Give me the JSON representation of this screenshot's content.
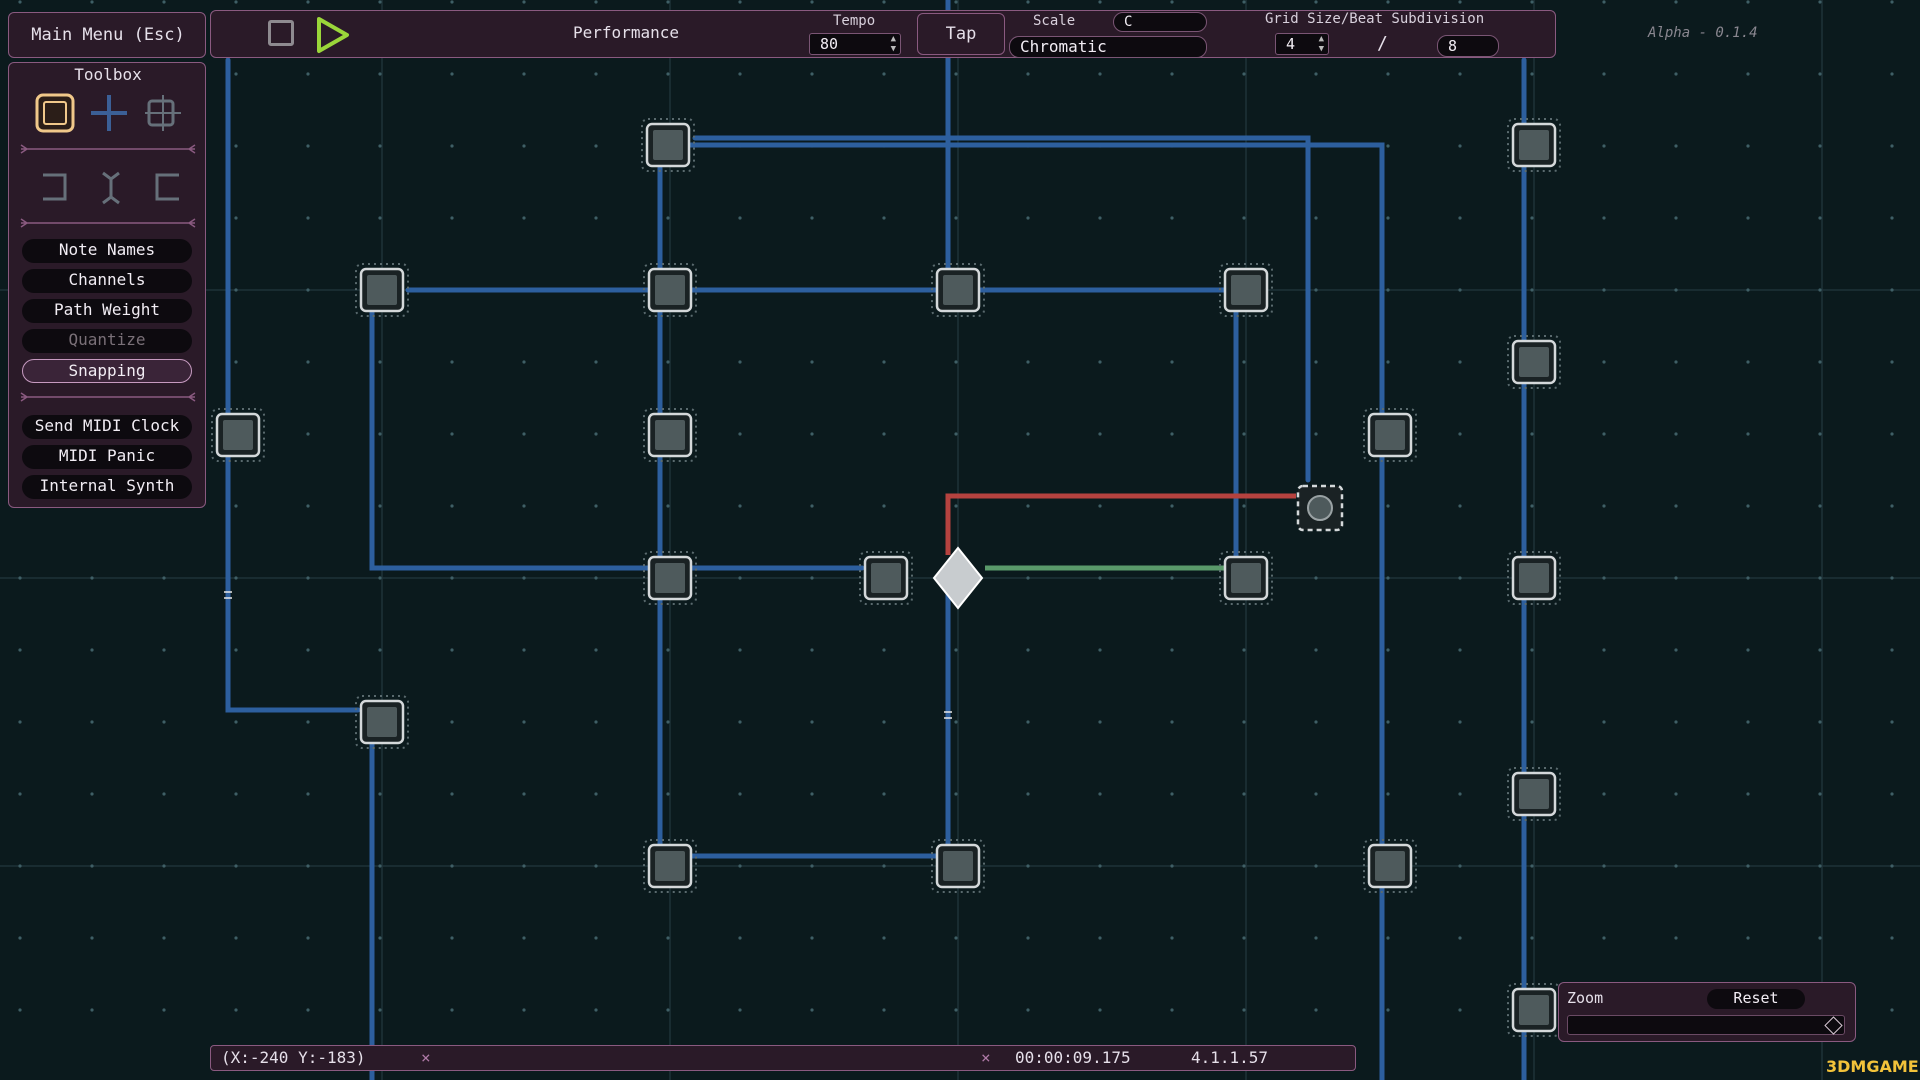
{
  "topbar": {
    "main_menu": "Main Menu (Esc)",
    "mode_label": "Performance",
    "tempo_label": "Tempo",
    "tempo_value": "80",
    "tap_label": "Tap",
    "scale_label": "Scale",
    "scale_root": "C",
    "scale_name": "Chromatic",
    "grid_label": "Grid Size/Beat Subdivision",
    "grid_size": "4",
    "grid_divider": "/",
    "beat_subdivision": "8",
    "version": "Alpha - 0.1.4"
  },
  "toolbox": {
    "title": "Toolbox",
    "options": [
      {
        "label": "Note Names",
        "state": "normal"
      },
      {
        "label": "Channels",
        "state": "normal"
      },
      {
        "label": "Path Weight",
        "state": "normal"
      },
      {
        "label": "Quantize",
        "state": "disabled"
      },
      {
        "label": "Snapping",
        "state": "selected"
      }
    ],
    "actions": [
      {
        "label": "Send MIDI Clock"
      },
      {
        "label": "MIDI Panic"
      },
      {
        "label": "Internal Synth"
      }
    ]
  },
  "status": {
    "coords": "(X:-240 Y:-183)",
    "time": "00:00:09.175",
    "position": "4.1.1.57"
  },
  "zoom": {
    "label": "Zoom",
    "reset": "Reset"
  },
  "watermark": "3DMGAME",
  "colors": {
    "path_blue": "#2d5f9e",
    "path_red": "#b5423f",
    "path_green": "#5a9a6a",
    "play_green": "#9bd63a",
    "node_fill": "#4e5a5c",
    "panel_border": "#8a5a80"
  }
}
